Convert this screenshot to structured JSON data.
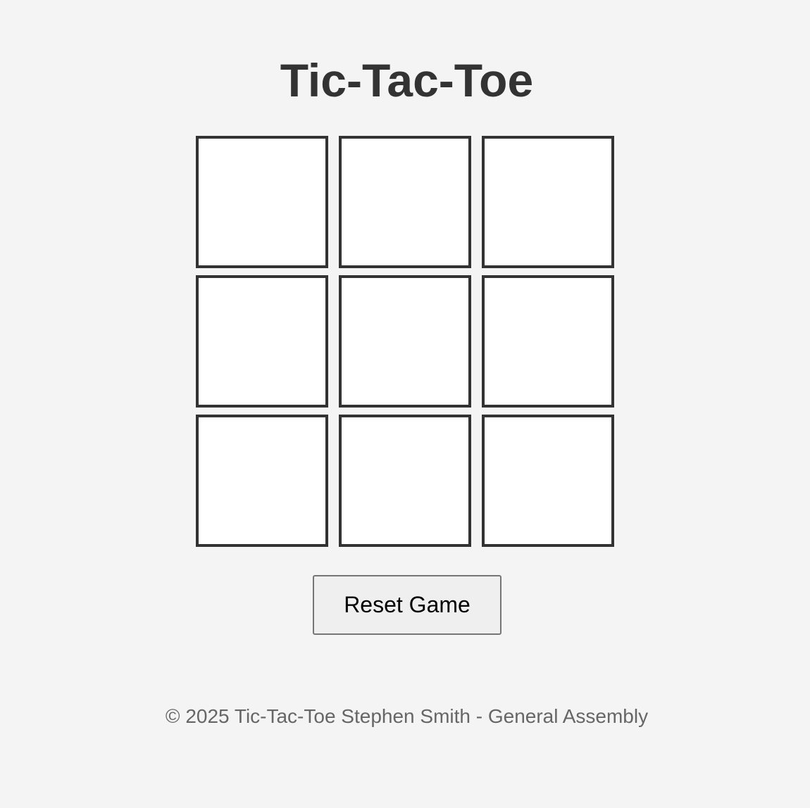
{
  "header": {
    "title": "Tic-Tac-Toe"
  },
  "board": {
    "cells": [
      "",
      "",
      "",
      "",
      "",
      "",
      "",
      "",
      ""
    ]
  },
  "controls": {
    "reset_label": "Reset Game"
  },
  "footer": {
    "text": "© 2025 Tic-Tac-Toe Stephen Smith - General Assembly"
  },
  "colors": {
    "background": "#f4f4f4",
    "text": "#333333",
    "cell_background": "#ffffff",
    "cell_border": "#333333",
    "button_background": "#efefef",
    "button_border": "#767676",
    "footer_text": "#666666"
  }
}
